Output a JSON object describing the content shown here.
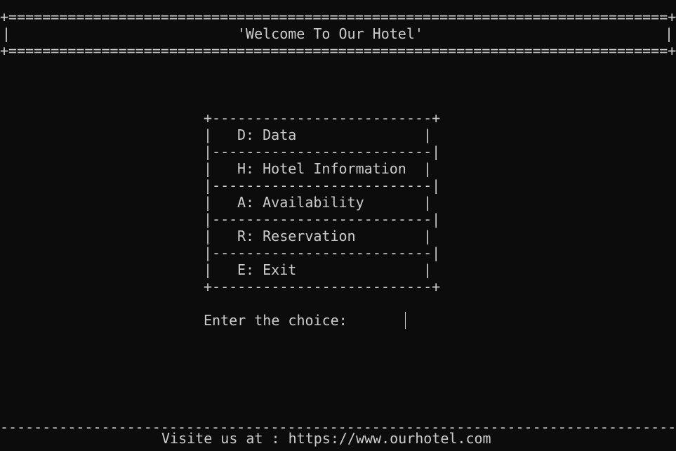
{
  "header": {
    "top_border": "+==============================================================================+",
    "title": "'Welcome To Our Hotel'",
    "bottom_border": "+==============================================================================+",
    "side_bar": "|"
  },
  "menu": {
    "top_border": "+--------------------------+",
    "separator": "|--------------------------|",
    "bottom_border": "+--------------------------+",
    "side_bar": "|",
    "items": [
      {
        "label": "D: Data"
      },
      {
        "label": "H: Hotel Information"
      },
      {
        "label": "A: Availability"
      },
      {
        "label": "R: Reservation"
      },
      {
        "label": "E: Exit"
      }
    ]
  },
  "prompt": {
    "text": "Enter the choice:"
  },
  "footer": {
    "rule": "--------------------------------------------------------------------------------",
    "text": "Visite us at : https://www.ourhotel.com"
  }
}
